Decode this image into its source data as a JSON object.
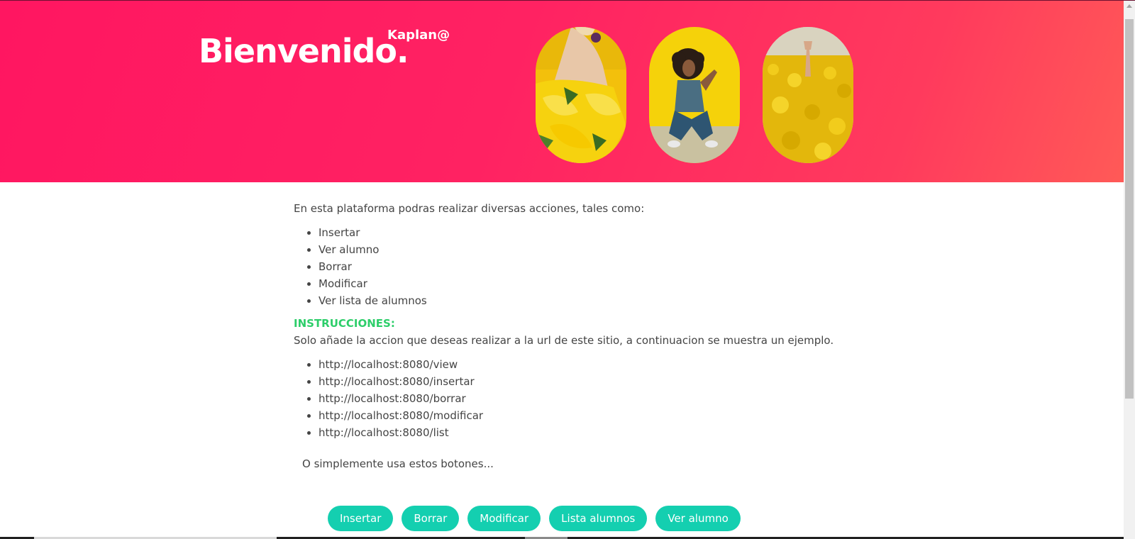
{
  "hero": {
    "title": "Bienvenido.",
    "user": "Kaplan@",
    "images": [
      "woman-with-sunflowers-photo",
      "woman-crouching-yellow-wall-photo",
      "hand-in-rapeseed-field-photo"
    ]
  },
  "content": {
    "intro": "En esta plataforma podras realizar diversas acciones, tales como:",
    "actions": [
      "Insertar",
      "Ver alumno",
      "Borrar",
      "Modificar",
      "Ver lista de alumnos"
    ],
    "instructions_title": "INSTRUCCIONES:",
    "instructions_text": "Solo añade la accion que deseas realizar a la url de este sitio, a continuacion se muestra un ejemplo.",
    "urls": [
      "http://localhost:8080/view",
      "http://localhost:8080/insertar",
      "http://localhost:8080/borrar",
      "http://localhost:8080/modificar",
      "http://localhost:8080/list"
    ],
    "hint": "O simplemente usa estos botones..."
  },
  "buttons": [
    "Insertar",
    "Borrar",
    "Modificar",
    "Lista alumnos",
    "Ver alumno"
  ],
  "colors": {
    "hero_gradient_start": "#ff1661",
    "hero_gradient_end": "#ff5a57",
    "instructions_title": "#2dce6a",
    "button_bg": "#14cfb0"
  }
}
